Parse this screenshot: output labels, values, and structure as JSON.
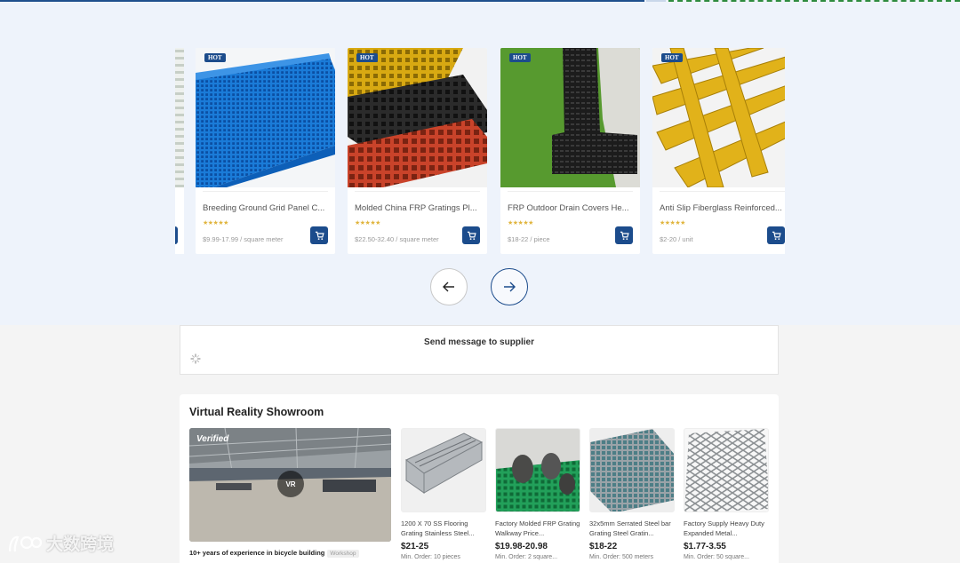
{
  "carousel": {
    "products": [
      {
        "badge": "HOT",
        "title": "Breeding Ground Grid Panel C...",
        "stars": "★★★★★",
        "price": "$9.99-17.99 / square meter"
      },
      {
        "badge": "HOT",
        "title": "Molded China FRP Gratings Pl...",
        "stars": "★★★★★",
        "price": "$22.50-32.40 / square meter"
      },
      {
        "badge": "HOT",
        "title": "FRP Outdoor Drain Covers He...",
        "stars": "★★★★★",
        "price": "$18-22 / piece"
      },
      {
        "badge": "HOT",
        "title": "Anti Slip Fiberglass Reinforced...",
        "stars": "★★★★★",
        "price": "$2-20 / unit"
      }
    ],
    "prev_icon": "arrow-left-icon",
    "next_icon": "arrow-right-icon"
  },
  "send_message": {
    "label": "Send message to supplier"
  },
  "vr_showroom": {
    "heading": "Virtual Reality Showroom",
    "verified": "Verified",
    "vr_badge": "VR",
    "caption": "10+ years of experience in bicycle building",
    "caption_tag": "Workshop",
    "products": [
      {
        "name": "1200 X 70 SS Flooring Grating Stainless Steel...",
        "price": "$21-25",
        "moq": "Min. Order: 10 pieces"
      },
      {
        "name": "Factory Molded FRP Grating Walkway Price...",
        "price": "$19.98-20.98",
        "moq": "Min. Order: 2 square..."
      },
      {
        "name": "32x5mm Serrated Steel bar Grating Steel Gratin...",
        "price": "$18-22",
        "moq": "Min. Order: 500 meters"
      },
      {
        "name": "Factory Supply Heavy Duty Expanded Metal...",
        "price": "$1.77-3.55",
        "moq": "Min. Order: 50 square..."
      }
    ]
  },
  "watermark": {
    "text": "大数跨境"
  },
  "colors": {
    "brand": "#1c4c8c",
    "star": "#e0b43c",
    "band": "#eef3fb"
  }
}
